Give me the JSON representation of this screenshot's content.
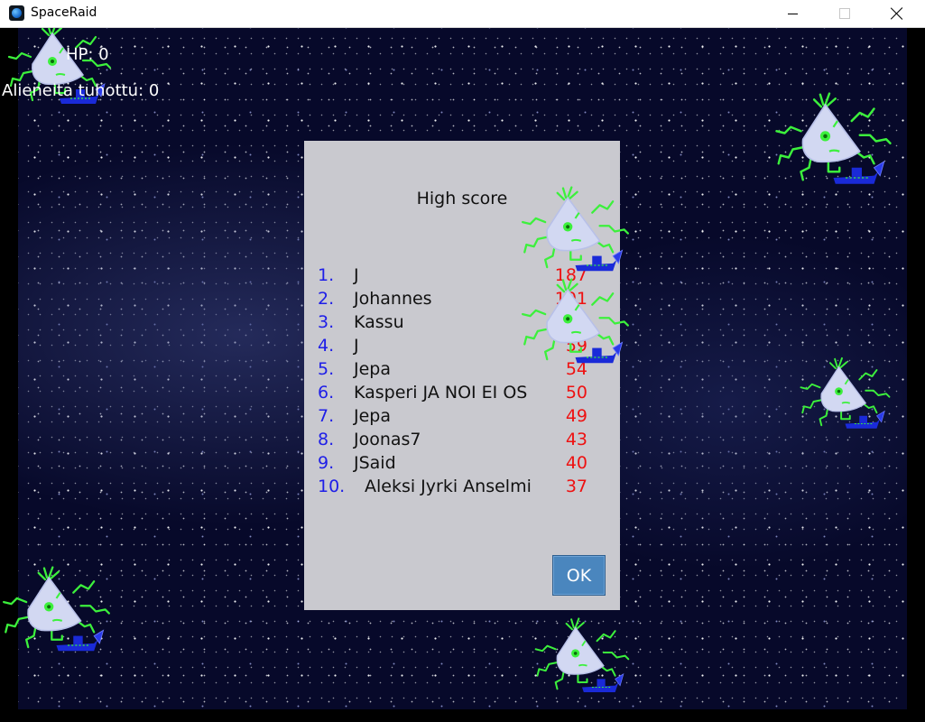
{
  "window": {
    "title": "SpaceRaid",
    "icon": "app-icon",
    "controls": [
      "minimize-icon",
      "maximize-icon",
      "close-icon"
    ]
  },
  "hud": {
    "hp_text": "HP: 0",
    "kills_text": "Alieneita tuhottu: 0"
  },
  "dialog": {
    "title": "High score",
    "ok_label": "OK",
    "entries": [
      {
        "rank": "1.",
        "name": "J",
        "score": "187"
      },
      {
        "rank": "2.",
        "name": "Johannes",
        "score": "101"
      },
      {
        "rank": "3.",
        "name": "Kassu",
        "score": "88"
      },
      {
        "rank": "4.",
        "name": "J",
        "score": "59"
      },
      {
        "rank": "5.",
        "name": "Jepa",
        "score": "54"
      },
      {
        "rank": "6.",
        "name": "Kasperi JA NOI EI OS",
        "score": "50"
      },
      {
        "rank": "7.",
        "name": "Jepa",
        "score": "49"
      },
      {
        "rank": "8.",
        "name": "Joonas7",
        "score": "43"
      },
      {
        "rank": "9.",
        "name": "JSaid",
        "score": "40"
      },
      {
        "rank": "10.",
        "name": "Aleksi Jyrki Anselmi",
        "score": "37"
      }
    ]
  },
  "colors": {
    "rank": "#1e1ee8",
    "score": "#ee1111",
    "dialog_bg": "#c9c9cf",
    "ok_button": "#4a86be",
    "alien_body": "#d2d8f2",
    "alien_tentacle": "#3cf03c",
    "alien_ship": "#1a2ad8"
  }
}
